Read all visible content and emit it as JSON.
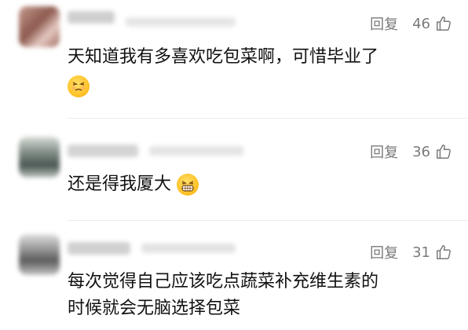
{
  "comments": [
    {
      "reply_label": "回复",
      "likes": "46",
      "text_lines": [
        "天知道我有多喜欢吃包菜啊，可惜毕业了"
      ],
      "emoji": "sleepy-face-emoji"
    },
    {
      "reply_label": "回复",
      "likes": "36",
      "text_lines": [
        "还是得我厦大"
      ],
      "emoji": "grinning-teeth-emoji"
    },
    {
      "reply_label": "回复",
      "likes": "31",
      "text_lines": [
        "每次觉得自己应该吃点蔬菜补充维生素的",
        "时候就会无脑选择包菜"
      ],
      "emoji": ""
    }
  ],
  "icons": {
    "like": "thumb-up-icon"
  },
  "colors": {
    "meta_text": "#7a7a7a",
    "body_text": "#111111",
    "emoji_yellow": "#ffc42a"
  }
}
